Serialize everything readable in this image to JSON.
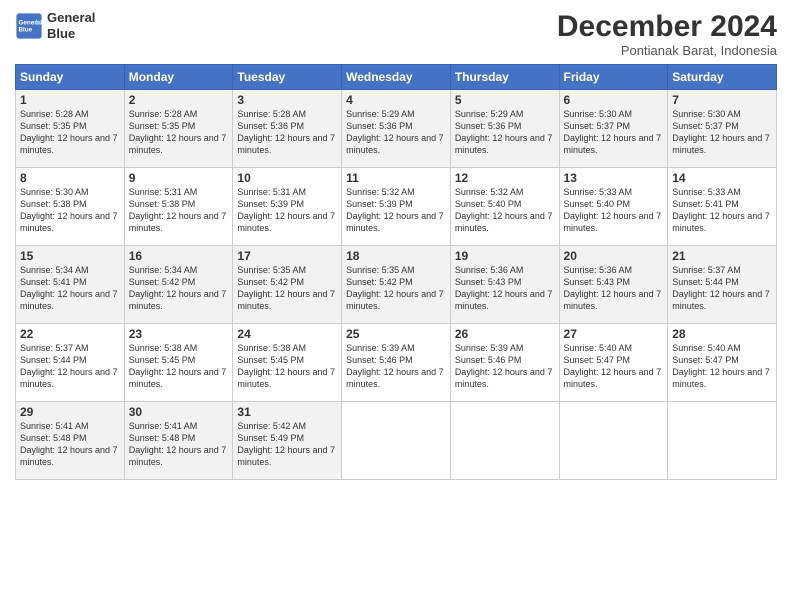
{
  "header": {
    "logo_line1": "General",
    "logo_line2": "Blue",
    "month_title": "December 2024",
    "location": "Pontianak Barat, Indonesia"
  },
  "columns": [
    "Sunday",
    "Monday",
    "Tuesday",
    "Wednesday",
    "Thursday",
    "Friday",
    "Saturday"
  ],
  "weeks": [
    [
      {
        "day": "1",
        "info": "Sunrise: 5:28 AM\nSunset: 5:35 PM\nDaylight: 12 hours\nand 7 minutes."
      },
      {
        "day": "2",
        "info": "Sunrise: 5:28 AM\nSunset: 5:35 PM\nDaylight: 12 hours\nand 7 minutes."
      },
      {
        "day": "3",
        "info": "Sunrise: 5:28 AM\nSunset: 5:36 PM\nDaylight: 12 hours\nand 7 minutes."
      },
      {
        "day": "4",
        "info": "Sunrise: 5:29 AM\nSunset: 5:36 PM\nDaylight: 12 hours\nand 7 minutes."
      },
      {
        "day": "5",
        "info": "Sunrise: 5:29 AM\nSunset: 5:36 PM\nDaylight: 12 hours\nand 7 minutes."
      },
      {
        "day": "6",
        "info": "Sunrise: 5:30 AM\nSunset: 5:37 PM\nDaylight: 12 hours\nand 7 minutes."
      },
      {
        "day": "7",
        "info": "Sunrise: 5:30 AM\nSunset: 5:37 PM\nDaylight: 12 hours\nand 7 minutes."
      }
    ],
    [
      {
        "day": "8",
        "info": "Sunrise: 5:30 AM\nSunset: 5:38 PM\nDaylight: 12 hours\nand 7 minutes."
      },
      {
        "day": "9",
        "info": "Sunrise: 5:31 AM\nSunset: 5:38 PM\nDaylight: 12 hours\nand 7 minutes."
      },
      {
        "day": "10",
        "info": "Sunrise: 5:31 AM\nSunset: 5:39 PM\nDaylight: 12 hours\nand 7 minutes."
      },
      {
        "day": "11",
        "info": "Sunrise: 5:32 AM\nSunset: 5:39 PM\nDaylight: 12 hours\nand 7 minutes."
      },
      {
        "day": "12",
        "info": "Sunrise: 5:32 AM\nSunset: 5:40 PM\nDaylight: 12 hours\nand 7 minutes."
      },
      {
        "day": "13",
        "info": "Sunrise: 5:33 AM\nSunset: 5:40 PM\nDaylight: 12 hours\nand 7 minutes."
      },
      {
        "day": "14",
        "info": "Sunrise: 5:33 AM\nSunset: 5:41 PM\nDaylight: 12 hours\nand 7 minutes."
      }
    ],
    [
      {
        "day": "15",
        "info": "Sunrise: 5:34 AM\nSunset: 5:41 PM\nDaylight: 12 hours\nand 7 minutes."
      },
      {
        "day": "16",
        "info": "Sunrise: 5:34 AM\nSunset: 5:42 PM\nDaylight: 12 hours\nand 7 minutes."
      },
      {
        "day": "17",
        "info": "Sunrise: 5:35 AM\nSunset: 5:42 PM\nDaylight: 12 hours\nand 7 minutes."
      },
      {
        "day": "18",
        "info": "Sunrise: 5:35 AM\nSunset: 5:42 PM\nDaylight: 12 hours\nand 7 minutes."
      },
      {
        "day": "19",
        "info": "Sunrise: 5:36 AM\nSunset: 5:43 PM\nDaylight: 12 hours\nand 7 minutes."
      },
      {
        "day": "20",
        "info": "Sunrise: 5:36 AM\nSunset: 5:43 PM\nDaylight: 12 hours\nand 7 minutes."
      },
      {
        "day": "21",
        "info": "Sunrise: 5:37 AM\nSunset: 5:44 PM\nDaylight: 12 hours\nand 7 minutes."
      }
    ],
    [
      {
        "day": "22",
        "info": "Sunrise: 5:37 AM\nSunset: 5:44 PM\nDaylight: 12 hours\nand 7 minutes."
      },
      {
        "day": "23",
        "info": "Sunrise: 5:38 AM\nSunset: 5:45 PM\nDaylight: 12 hours\nand 7 minutes."
      },
      {
        "day": "24",
        "info": "Sunrise: 5:38 AM\nSunset: 5:45 PM\nDaylight: 12 hours\nand 7 minutes."
      },
      {
        "day": "25",
        "info": "Sunrise: 5:39 AM\nSunset: 5:46 PM\nDaylight: 12 hours\nand 7 minutes."
      },
      {
        "day": "26",
        "info": "Sunrise: 5:39 AM\nSunset: 5:46 PM\nDaylight: 12 hours\nand 7 minutes."
      },
      {
        "day": "27",
        "info": "Sunrise: 5:40 AM\nSunset: 5:47 PM\nDaylight: 12 hours\nand 7 minutes."
      },
      {
        "day": "28",
        "info": "Sunrise: 5:40 AM\nSunset: 5:47 PM\nDaylight: 12 hours\nand 7 minutes."
      }
    ],
    [
      {
        "day": "29",
        "info": "Sunrise: 5:41 AM\nSunset: 5:48 PM\nDaylight: 12 hours\nand 7 minutes."
      },
      {
        "day": "30",
        "info": "Sunrise: 5:41 AM\nSunset: 5:48 PM\nDaylight: 12 hours\nand 7 minutes."
      },
      {
        "day": "31",
        "info": "Sunrise: 5:42 AM\nSunset: 5:49 PM\nDaylight: 12 hours\nand 7 minutes."
      },
      {
        "day": "",
        "info": ""
      },
      {
        "day": "",
        "info": ""
      },
      {
        "day": "",
        "info": ""
      },
      {
        "day": "",
        "info": ""
      }
    ]
  ]
}
